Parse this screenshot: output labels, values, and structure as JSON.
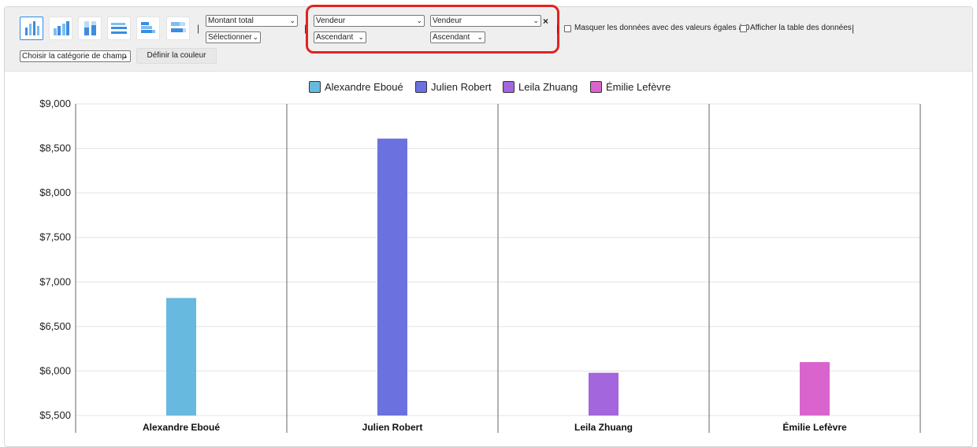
{
  "toolbar": {
    "chart_types": [
      {
        "icon": "vertical-bar-chart-icon",
        "active": true
      },
      {
        "icon": "vertical-grouped-bar-icon",
        "active": false
      },
      {
        "icon": "vertical-stacked-bar-icon",
        "active": false
      },
      {
        "icon": "horizontal-bar-chart-icon",
        "active": false
      },
      {
        "icon": "horizontal-grouped-bar-icon",
        "active": false
      },
      {
        "icon": "horizontal-stacked-bar-icon",
        "active": false
      }
    ],
    "measure_select": "Montant total",
    "aggregate_select": "Sélectionner",
    "sort_field_1": "Vendeur",
    "sort_order_1": "Ascendant",
    "sort_field_2": "Vendeur",
    "sort_order_2": "Ascendant",
    "remove_label": "×",
    "hide_zero_label": "Masquer les données avec des valeurs égales à 0",
    "show_table_label": "Afficher la table des données",
    "category_select": "Choisir la catégorie de champ",
    "set_color_label": "Définir la couleur",
    "separator": "|"
  },
  "chart_data": {
    "type": "bar",
    "categories": [
      "Alexandre Eboué",
      "Julien Robert",
      "Leila Zhuang",
      "Émilie Lefèvre"
    ],
    "values": [
      6820,
      8610,
      5980,
      6100
    ],
    "colors": [
      "#67b9e0",
      "#6b71de",
      "#a366dc",
      "#d964ce"
    ],
    "legend": [
      "Alexandre Eboué",
      "Julien Robert",
      "Leila Zhuang",
      "Émilie Lefèvre"
    ],
    "legend_position": "top-center",
    "ylim": [
      5500,
      9000
    ],
    "yticks": [
      5500,
      6000,
      6500,
      7000,
      7500,
      8000,
      8500,
      9000
    ],
    "ytick_labels": [
      "$5,500",
      "$6,000",
      "$6,500",
      "$7,000",
      "$7,500",
      "$8,000",
      "$8,500",
      "$9,000"
    ],
    "grid": true
  }
}
